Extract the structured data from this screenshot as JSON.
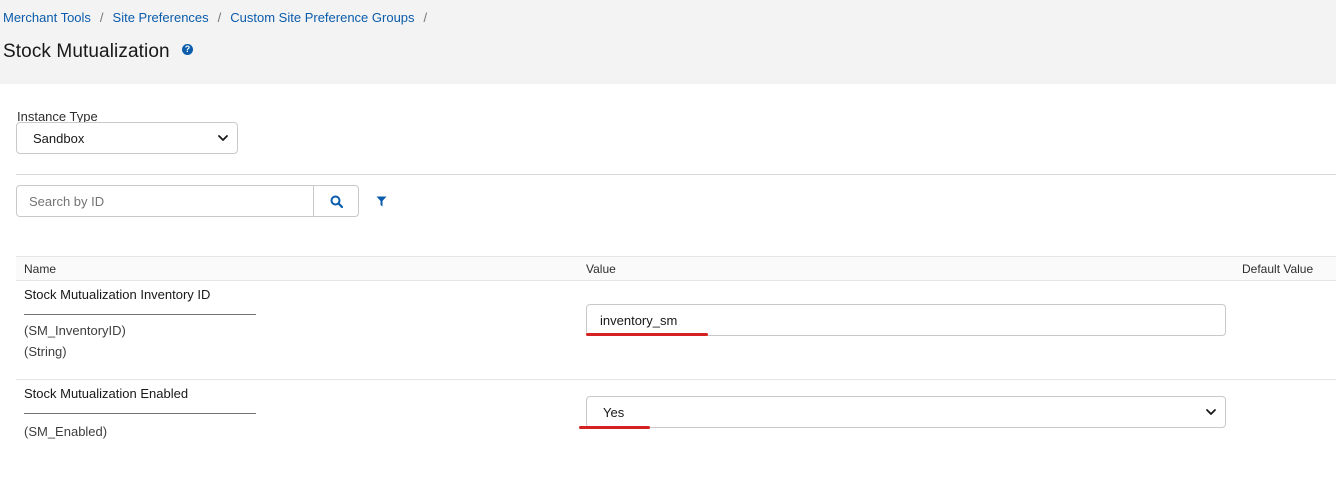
{
  "breadcrumb": [
    {
      "label": "Merchant Tools"
    },
    {
      "label": "Site Preferences"
    },
    {
      "label": "Custom Site Preference Groups"
    }
  ],
  "breadcrumb_separator": "/",
  "page_title": "Stock Mutualization",
  "help_icon_glyph": "?",
  "instance_type": {
    "label": "Instance Type",
    "selected": "Sandbox"
  },
  "search": {
    "placeholder": "Search by ID"
  },
  "table": {
    "columns": [
      "Name",
      "Value",
      "Default Value"
    ],
    "rows": [
      {
        "title": "Stock Mutualization Inventory ID",
        "id": "(SM_InventoryID)",
        "type": "(String)",
        "value": "inventory_sm",
        "control": "text-input"
      },
      {
        "title": "Stock Mutualization Enabled",
        "id": "(SM_Enabled)",
        "value": "Yes",
        "control": "select"
      }
    ]
  },
  "colors": {
    "link": "#0b5cab",
    "header_bg": "#f3f3f3",
    "annotation_red": "#d42121"
  },
  "icons": [
    "help-icon",
    "search-icon",
    "filter-icon",
    "chevron-down-icon"
  ]
}
